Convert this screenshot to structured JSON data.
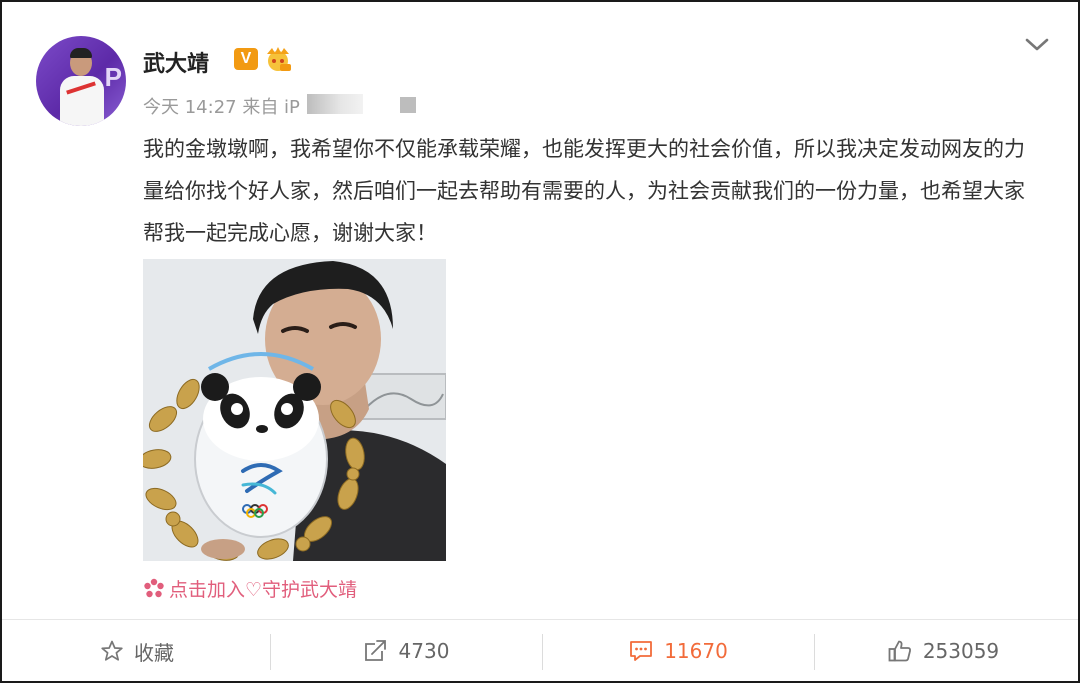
{
  "post": {
    "username": "武大靖",
    "verified_badge": "V",
    "meta": "今天 14:27 来自 iP",
    "content": "我的金墩墩啊，我希望你不仅能承载荣耀，也能发挥更大的社会价值，所以我决定发动网友的力量给你找个好人家，然后咱们一起去帮助有需要的人，为社会贡献我们的一份力量，也希望大家帮我一起完成心愿，谢谢大家！",
    "supertopic": "点击加入♡守护武大靖"
  },
  "toolbar": {
    "favorite_label": "收藏",
    "repost_count": "4730",
    "comment_count": "11670",
    "like_count": "253059"
  },
  "icons": {
    "favorite": "star-icon",
    "repost": "share-icon",
    "comment": "comment-icon",
    "like": "thumbs-up-icon",
    "more": "chevron-down-icon"
  },
  "colors": {
    "accent": "#f26b3a",
    "topic": "#e15e7c",
    "badge": "#f29a12"
  }
}
